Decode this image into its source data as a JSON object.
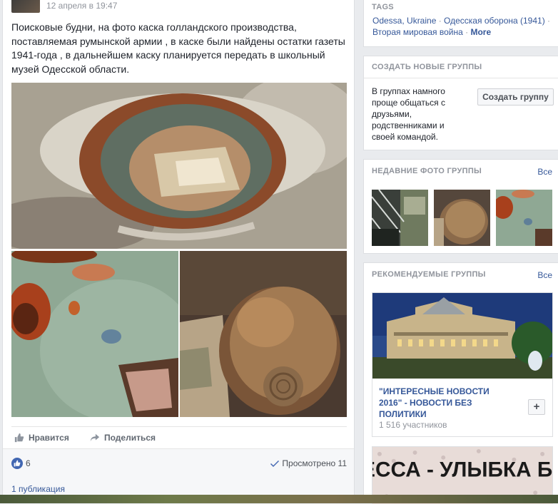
{
  "post": {
    "time": "12 апреля в 19:47",
    "text": "Поисковые будни, на фото каска голландского производства, поставляемая румынской армии , в каске были найдены остатки газеты 1941-года , в дальнейшем каску планируется передать в школьный музей Одесской области.",
    "photos": [
      "helmet-inside-photo",
      "helmet-closeup-photo",
      "helmet-outside-photo"
    ],
    "actions": {
      "like": "Нравится",
      "share": "Поделиться"
    },
    "likes": "6",
    "seen": "Просмотрено 11",
    "publications": "1 публикация"
  },
  "tags": {
    "title": "TAGS",
    "items": [
      "Odessa, Ukraine",
      "Одесская оборона (1941)",
      "Вторая мировая война"
    ],
    "separator": " · ",
    "more": "More"
  },
  "create_group": {
    "title": "СОЗДАТЬ НОВЫЕ ГРУППЫ",
    "text": "В группах намного проще общаться с друзьями, родственниками и своей командой.",
    "button": "Создать группу"
  },
  "recent_photos": {
    "title": "НЕДАВНИЕ ФОТО ГРУППЫ",
    "all": "Все"
  },
  "recommended": {
    "title": "РЕКОМЕНДУЕМЫЕ ГРУППЫ",
    "all": "Все",
    "group": {
      "name": "\"ИНТЕРЕСНЫЕ НОВОСТИ 2016\" - НОВОСТИ БЕЗ ПОЛИТИКИ",
      "members": "1 516 участников",
      "join": "+"
    },
    "group2_sign": "ОДЕССА - УЛЫБКА БОГА"
  },
  "colors": {
    "link": "#365899",
    "accent": "#4267b2",
    "muted": "#90949c"
  }
}
